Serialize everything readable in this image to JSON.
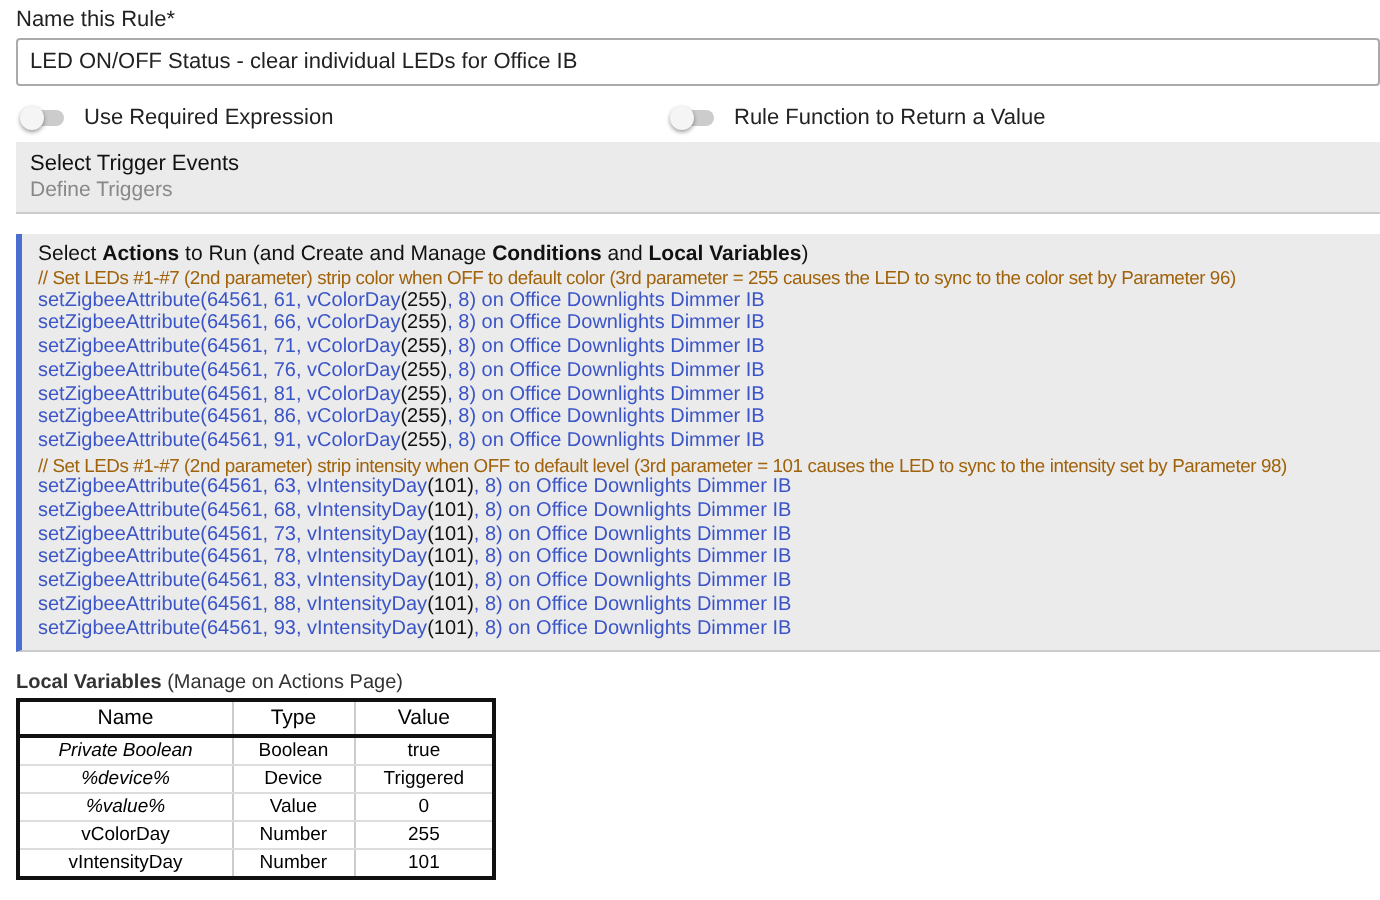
{
  "name_field": {
    "label": "Name this Rule*",
    "value": "LED ON/OFF Status - clear individual LEDs for Office IB"
  },
  "toggles": [
    {
      "label": "Use Required Expression",
      "on": false
    },
    {
      "label": "Rule Function to Return a Value",
      "on": false
    }
  ],
  "triggers": {
    "title": "Select Trigger Events",
    "subtitle": "Define Triggers"
  },
  "actions": {
    "title": "Select **Actions** to Run (and Create and Manage **Conditions** and **Local Variables**)",
    "lines": [
      {
        "kind": "comment",
        "text": "// Set LEDs #1-#7 (2nd parameter) strip color when OFF to default color (3rd parameter = 255 causes the LED to sync to the color set by Parameter 96)"
      },
      {
        "kind": "action",
        "before": "setZigbeeAttribute(64561, 61, vColorDay",
        "arg": "(255)",
        "after": ", 8) on Office Downlights Dimmer IB"
      },
      {
        "kind": "action",
        "before": "setZigbeeAttribute(64561, 66, vColorDay",
        "arg": "(255)",
        "after": ", 8) on Office Downlights Dimmer IB"
      },
      {
        "kind": "action",
        "before": "setZigbeeAttribute(64561, 71, vColorDay",
        "arg": "(255)",
        "after": ", 8) on Office Downlights Dimmer IB"
      },
      {
        "kind": "action",
        "before": "setZigbeeAttribute(64561, 76, vColorDay",
        "arg": "(255)",
        "after": ", 8) on Office Downlights Dimmer IB"
      },
      {
        "kind": "action",
        "before": "setZigbeeAttribute(64561, 81, vColorDay",
        "arg": "(255)",
        "after": ", 8) on Office Downlights Dimmer IB"
      },
      {
        "kind": "action",
        "before": "setZigbeeAttribute(64561, 86, vColorDay",
        "arg": "(255)",
        "after": ", 8) on Office Downlights Dimmer IB"
      },
      {
        "kind": "action",
        "before": "setZigbeeAttribute(64561, 91, vColorDay",
        "arg": "(255)",
        "after": ", 8) on Office Downlights Dimmer IB"
      },
      {
        "kind": "comment",
        "text": "// Set LEDs #1-#7 (2nd parameter) strip intensity when OFF to default level (3rd parameter = 101 causes the LED to sync to the intensity set by Parameter 98)"
      },
      {
        "kind": "action",
        "before": "setZigbeeAttribute(64561, 63, vIntensityDay",
        "arg": "(101)",
        "after": ", 8) on Office Downlights Dimmer IB"
      },
      {
        "kind": "action",
        "before": "setZigbeeAttribute(64561, 68, vIntensityDay",
        "arg": "(101)",
        "after": ", 8) on Office Downlights Dimmer IB"
      },
      {
        "kind": "action",
        "before": "setZigbeeAttribute(64561, 73, vIntensityDay",
        "arg": "(101)",
        "after": ", 8) on Office Downlights Dimmer IB"
      },
      {
        "kind": "action",
        "before": "setZigbeeAttribute(64561, 78, vIntensityDay",
        "arg": "(101)",
        "after": ", 8) on Office Downlights Dimmer IB"
      },
      {
        "kind": "action",
        "before": "setZigbeeAttribute(64561, 83, vIntensityDay",
        "arg": "(101)",
        "after": ", 8) on Office Downlights Dimmer IB"
      },
      {
        "kind": "action",
        "before": "setZigbeeAttribute(64561, 88, vIntensityDay",
        "arg": "(101)",
        "after": ", 8) on Office Downlights Dimmer IB"
      },
      {
        "kind": "action",
        "before": "setZigbeeAttribute(64561, 93, vIntensityDay",
        "arg": "(101)",
        "after": ", 8) on Office Downlights Dimmer IB"
      }
    ]
  },
  "local_variables": {
    "title": "**Local Variables** (Manage on Actions Page)",
    "columns": [
      "Name",
      "Type",
      "Value"
    ],
    "rows": [
      {
        "name": "Private Boolean",
        "type": "Boolean",
        "value": "true",
        "italic": true
      },
      {
        "name": "%device%",
        "type": "Device",
        "value": "Triggered",
        "italic": true
      },
      {
        "name": "%value%",
        "type": "Value",
        "value": "0",
        "italic": true
      },
      {
        "name": "vColorDay",
        "type": "Number",
        "value": "255",
        "italic": false
      },
      {
        "name": "vIntensityDay",
        "type": "Number",
        "value": "101",
        "italic": false
      }
    ]
  }
}
